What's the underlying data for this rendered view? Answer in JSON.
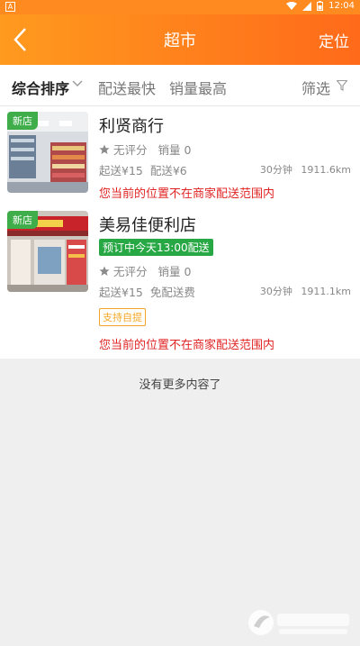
{
  "status": {
    "time": "12:04",
    "app_letter": "A"
  },
  "nav": {
    "title": "超市",
    "right": "定位"
  },
  "sort": {
    "tabs": [
      "综合排序",
      "配送最快",
      "销量最高"
    ],
    "filter": "筛选"
  },
  "stores": [
    {
      "tag": "新店",
      "name": "利贤商行",
      "rating": "无评分",
      "sales": "销量 0",
      "min_order": "起送¥15",
      "delivery_fee": "配送¥6",
      "time": "30分钟",
      "distance": "1911.6km",
      "warning": "您当前的位置不在商家配送范围内"
    },
    {
      "tag": "新店",
      "name": "美易佳便利店",
      "promo": "预订中今天13:00配送",
      "rating": "无评分",
      "sales": "销量 0",
      "min_order": "起送¥15",
      "delivery_fee": "免配送费",
      "time": "30分钟",
      "distance": "1911.1km",
      "pickup": "支持自提",
      "warning": "您当前的位置不在商家配送范围内"
    }
  ],
  "footer": {
    "no_more": "没有更多内容了"
  },
  "colors": {
    "primary": "#ff8a1f",
    "warning": "#e02424",
    "new_tag": "#3fae4a",
    "promo": "#27a845",
    "pickup": "#f5a623"
  }
}
